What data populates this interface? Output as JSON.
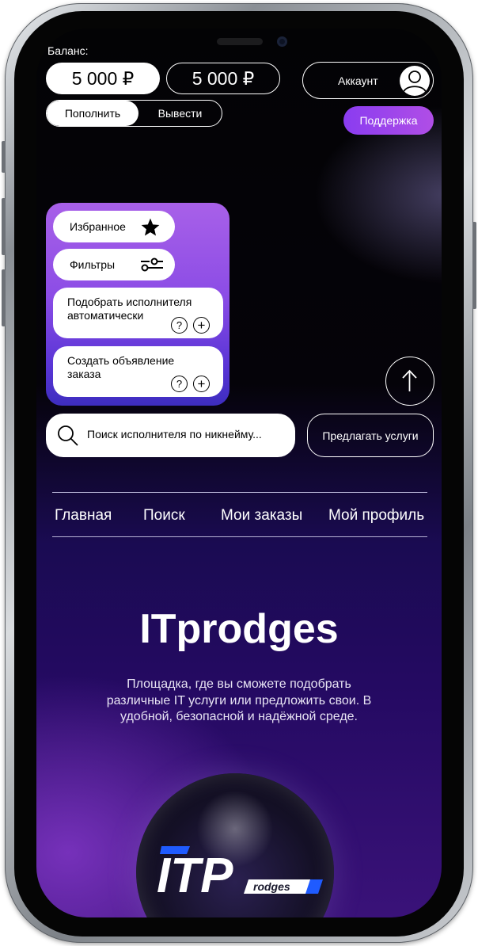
{
  "header": {
    "balance_label": "Баланс:",
    "balance_primary": "5 000 ₽",
    "balance_secondary": "5 000 ₽",
    "account_label": "Аккаунт",
    "topup_label": "Пополнить",
    "withdraw_label": "Вывести",
    "support_label": "Поддержка"
  },
  "menu": {
    "favorites_label": "Избранное",
    "filters_label": "Фильтры",
    "auto_pick_label": "Подобрать исполнителя автоматически",
    "create_ad_label": "Создать объявление заказа",
    "help_glyph": "?",
    "add_glyph": "+"
  },
  "search": {
    "placeholder": "Поиск исполнителя по никнейму...",
    "offer_services_label": "Предлагать услуги"
  },
  "nav": {
    "items": [
      {
        "label": "Главная"
      },
      {
        "label": "Поиск"
      },
      {
        "label": "Мои заказы"
      },
      {
        "label": "Мой профиль"
      }
    ]
  },
  "hero": {
    "title": "ITprodges",
    "description": "Площадка, где вы сможете подобрать различные IT услуги или предложить свои. В удобной, безопасной и надёжной среде.",
    "logo_text_big": "ITP",
    "logo_text_small": "rodges"
  },
  "colors": {
    "accent_purple": "#8a3cf0",
    "card_gradient_top": "#a860e8",
    "card_gradient_bottom": "#3d2dbf",
    "logo_blue": "#1f5bff"
  },
  "icons": [
    "star-icon",
    "filter-sliders-icon",
    "help-icon",
    "add-icon",
    "arrow-up-icon",
    "search-icon",
    "user-icon"
  ]
}
